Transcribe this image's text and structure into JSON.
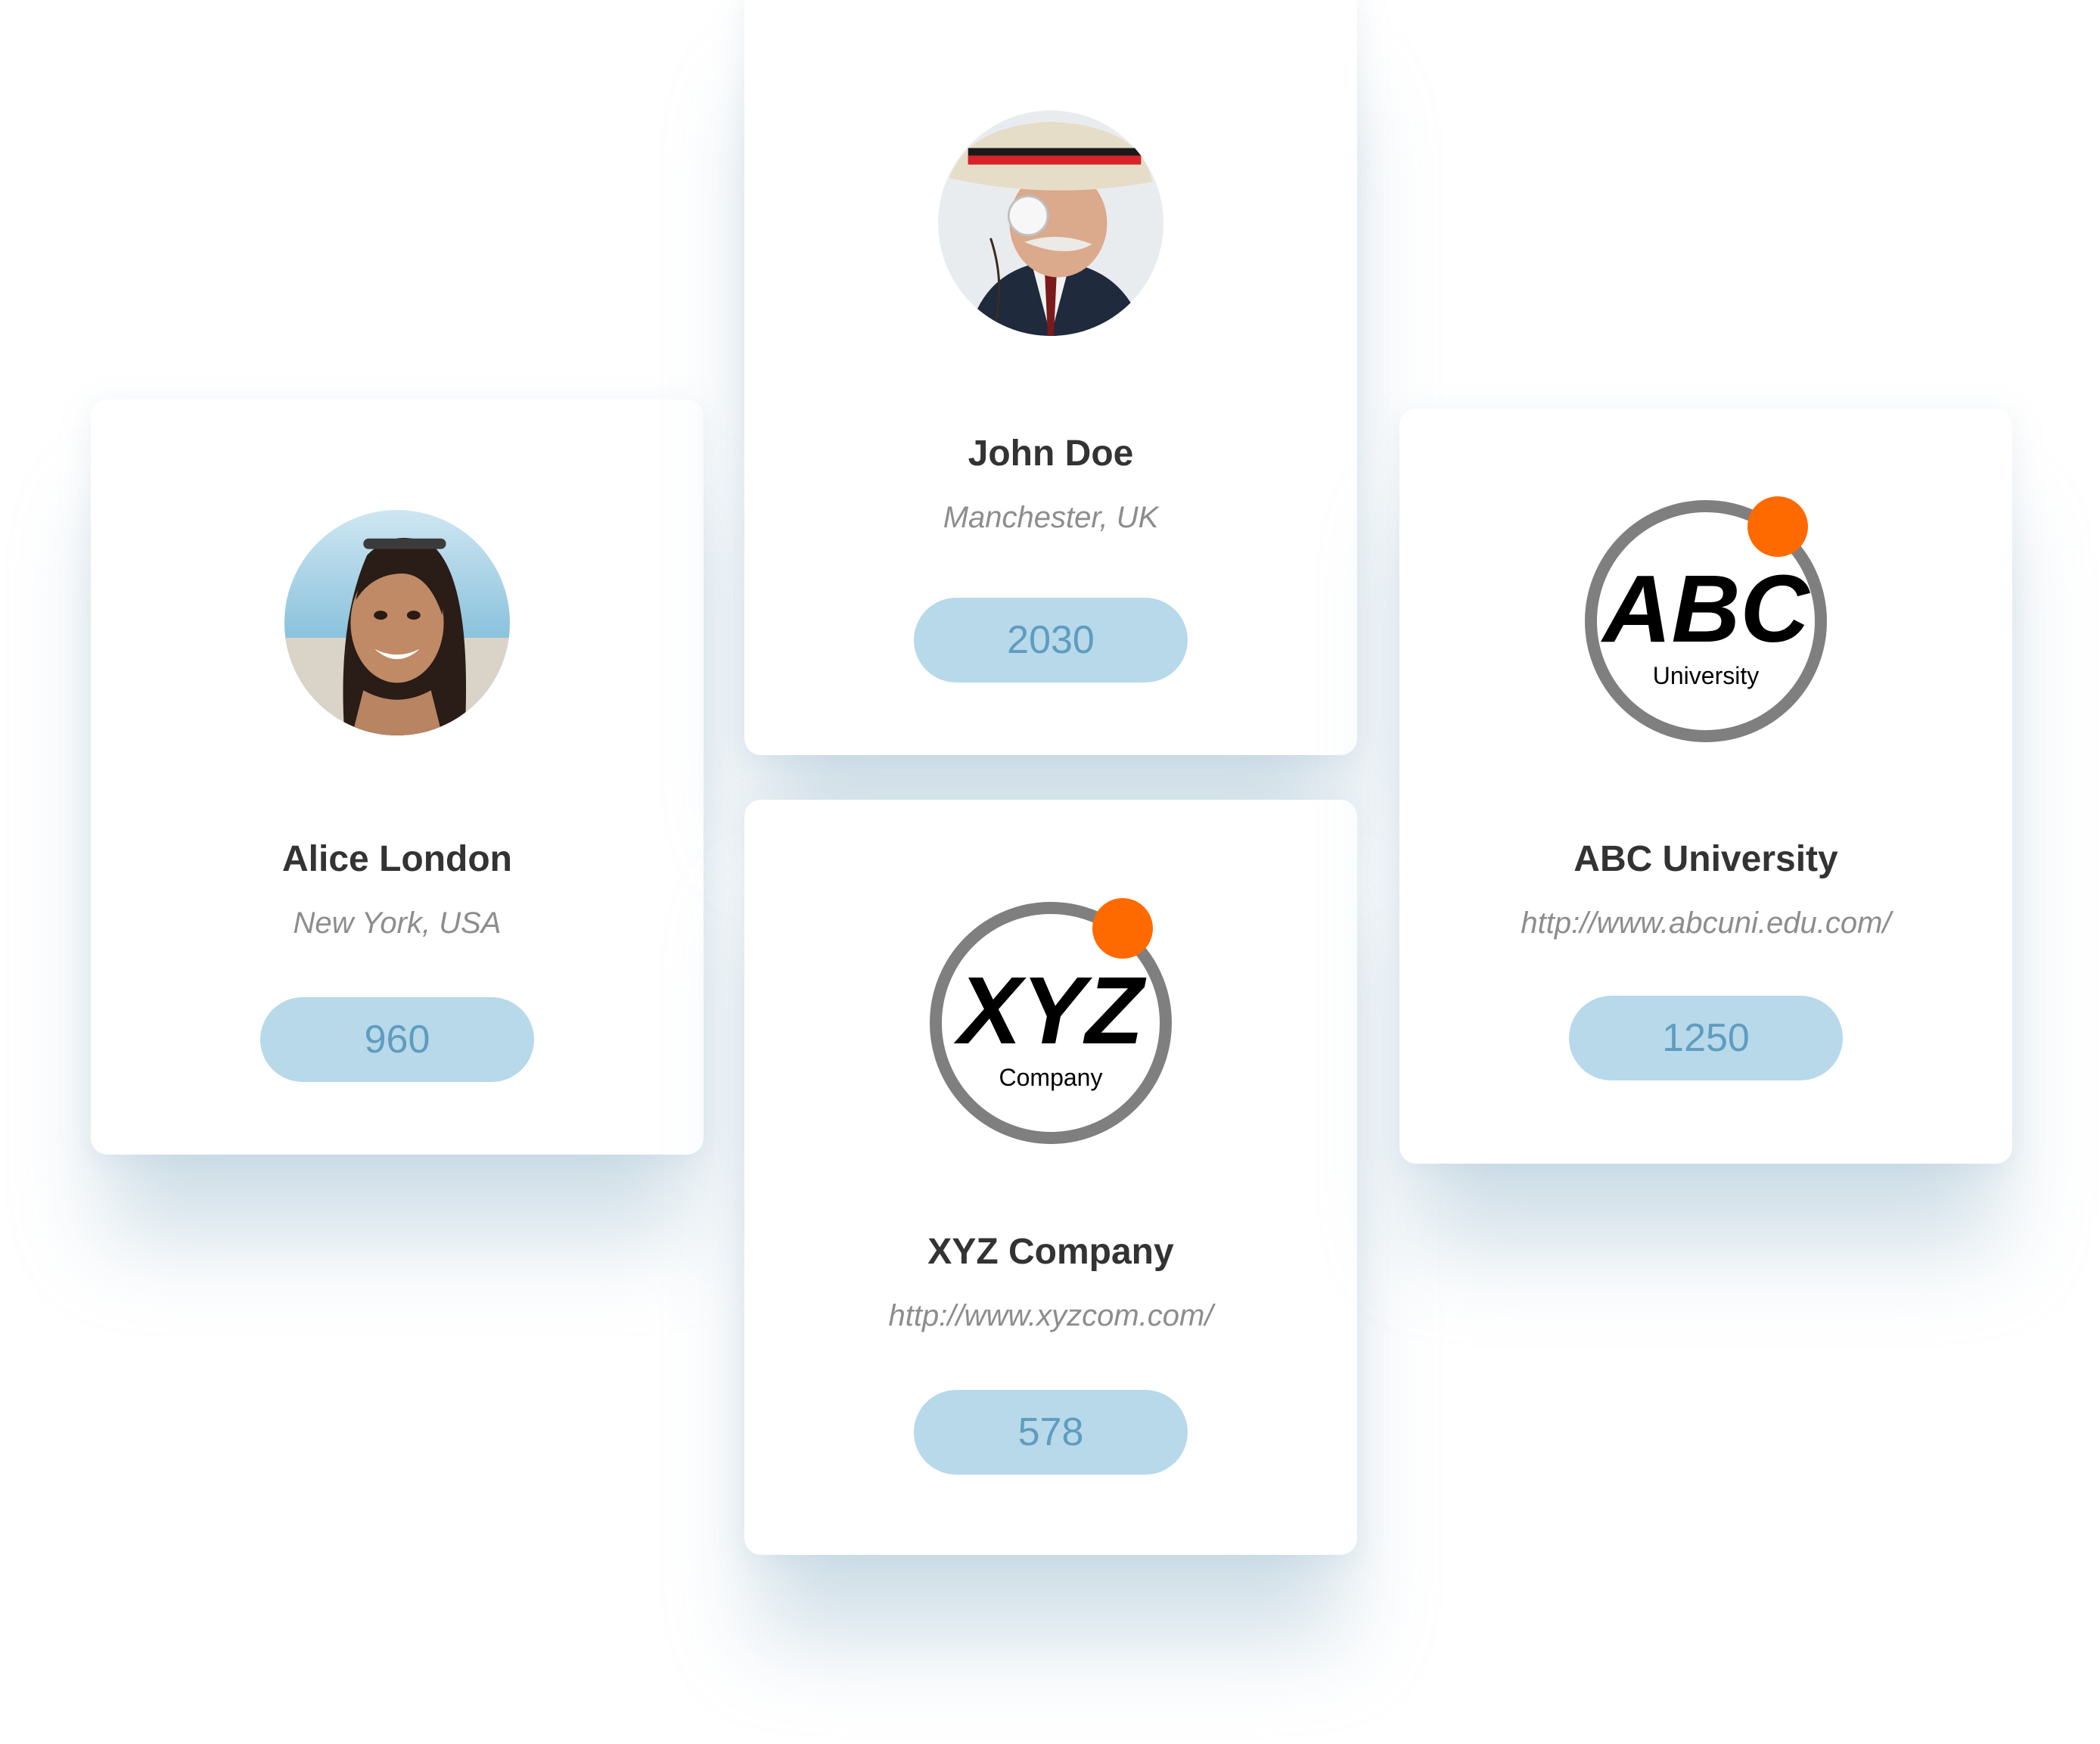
{
  "colors": {
    "pill_background": "#b7d9ea",
    "pill_text": "#5f9cc0",
    "logo_dot": "#ff6a00",
    "logo_ring": "#7f7f7f"
  },
  "cards": {
    "alice": {
      "avatar_icon": "person-avatar",
      "name": "Alice London",
      "location": "New York, USA",
      "count": "960"
    },
    "john": {
      "avatar_icon": "person-avatar",
      "name": "John Doe",
      "location": "Manchester, UK",
      "count": "2030"
    },
    "xyz": {
      "logo_title": "XYZ",
      "logo_subtitle": "Company",
      "name": "XYZ Company",
      "url": "http://www.xyzcom.com/",
      "count": "578"
    },
    "abc": {
      "logo_title": "ABC",
      "logo_subtitle": "University",
      "name": "ABC University",
      "url": "http://www.abcuni.edu.com/",
      "count": "1250"
    }
  }
}
